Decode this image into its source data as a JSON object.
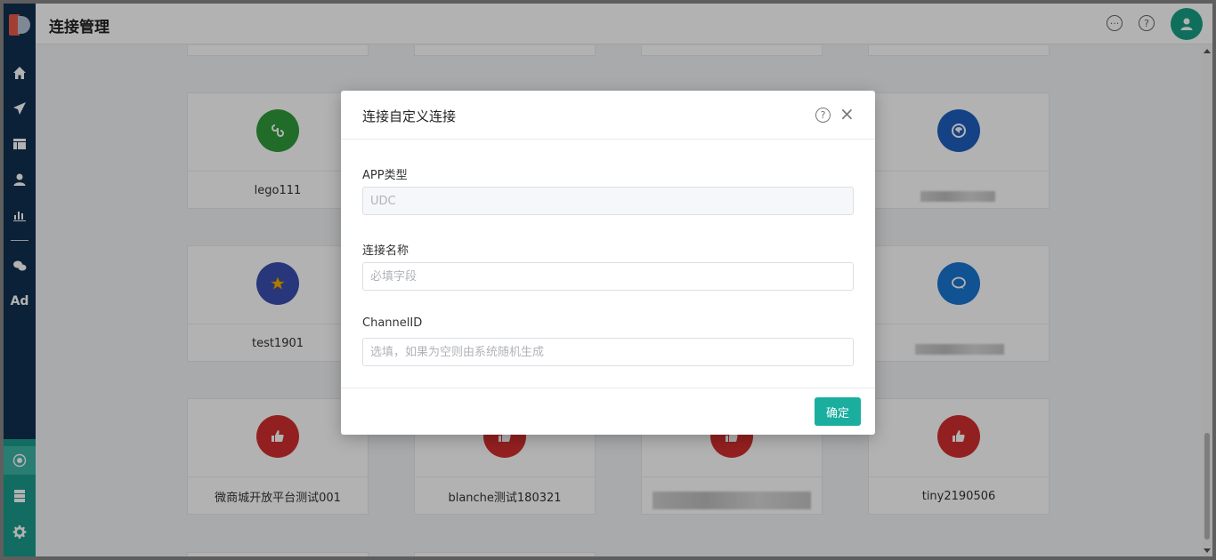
{
  "header": {
    "title": "连接管理",
    "icons": [
      "chat-bubble-icon",
      "help-icon",
      "user-avatar-icon"
    ]
  },
  "sidebar": {
    "items": [
      "home-icon",
      "send-icon",
      "layout-icon",
      "user-icon",
      "bar-chart-icon",
      "wechat-icon",
      "ad-icon",
      "connection-icon",
      "server-icon",
      "gear-icon"
    ],
    "ad_label": "Ad"
  },
  "cards": [
    {
      "label": "lego111",
      "color": "#2e9b3a",
      "icon": "mini-program-icon"
    },
    {
      "label": "",
      "color": "#1f5fbf",
      "icon": "weibo-like-icon"
    },
    {
      "label": "test1901",
      "color": "#3a4fb0",
      "icon": "star-icon"
    },
    {
      "label": "",
      "color": "#1976d2",
      "icon": "chat-icon"
    },
    {
      "label": "微商城开放平台测试001",
      "color": "#d32f2f",
      "icon": "thumb-up-icon"
    },
    {
      "label": "blanche测试180321",
      "color": "#d32f2f",
      "icon": "thumb-up-icon"
    },
    {
      "label": "",
      "color": "#d32f2f",
      "icon": "thumb-up-icon"
    },
    {
      "label": "tiny2190506",
      "color": "#d32f2f",
      "icon": "thumb-up-icon"
    }
  ],
  "modal": {
    "title": "连接自定义连接",
    "app_type_label": "APP类型",
    "app_type_value": "UDC",
    "name_label": "连接名称",
    "name_placeholder": "必填字段",
    "channel_label": "ChannelID",
    "channel_placeholder": "选填，如果为空则由系统随机生成",
    "confirm_label": "确定",
    "close_glyph": "×",
    "help_glyph": "?"
  },
  "colors": {
    "sidebar": "#0f3050",
    "accent": "#1aae9f",
    "avatar": "#16a085"
  }
}
